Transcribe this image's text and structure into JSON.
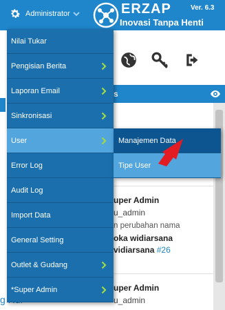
{
  "header": {
    "user_label": "Administrator",
    "brand": "ERZAP",
    "version": "Ver. 6.3",
    "tagline": "Inovasi Tanpa Henti"
  },
  "panel": {
    "title_fragment": "s"
  },
  "feed": [
    {
      "name": "uper Admin",
      "user": "u_admin",
      "text": "n perubahan nama",
      "bold1": "oka widiarsana",
      "bold2": "vidiarsana",
      "link": "#26"
    },
    {
      "name": "uper Admin",
      "user": "u_admin"
    }
  ],
  "bottom_fragment": "g Rul",
  "menu": {
    "items": [
      {
        "label": "Nilai Tukar",
        "has_submenu": false
      },
      {
        "label": "Pengisian Berita",
        "has_submenu": true
      },
      {
        "label": "Laporan Email",
        "has_submenu": true
      },
      {
        "label": "Sinkronisasi",
        "has_submenu": true
      },
      {
        "label": "User",
        "has_submenu": true,
        "active": true
      },
      {
        "label": "Error Log",
        "has_submenu": false
      },
      {
        "label": "Audit Log",
        "has_submenu": false
      },
      {
        "label": "Import Data",
        "has_submenu": false
      },
      {
        "label": "General Setting",
        "has_submenu": false
      },
      {
        "label": "Outlet & Gudang",
        "has_submenu": true
      },
      {
        "label": "*Super Admin",
        "has_submenu": true
      }
    ]
  },
  "submenu": {
    "items": [
      {
        "label": "Manajemen Data"
      },
      {
        "label": "Tipe User"
      }
    ]
  },
  "colors": {
    "header_bg": "#1f86cc",
    "menu_bg": "#1b6fad",
    "menu_active": "#52a5dd",
    "submenu_first": "#0d5590",
    "arrow_red": "#e31b23"
  }
}
